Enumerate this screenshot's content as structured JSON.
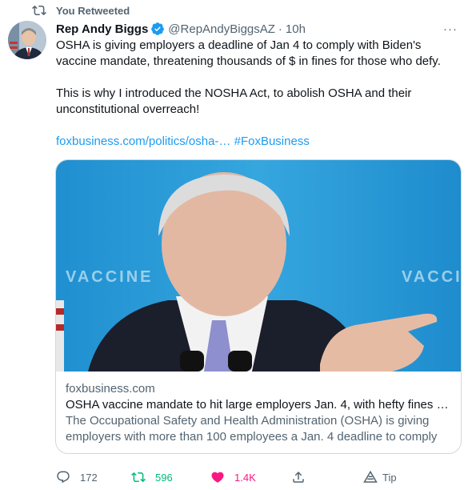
{
  "retweet_banner": {
    "label": "You Retweeted"
  },
  "author": {
    "name": "Rep Andy Biggs",
    "handle": "@RepAndyBiggsAZ",
    "separator": "·",
    "time": "10h"
  },
  "more_label": "···",
  "body": {
    "paragraph_1": "OSHA is giving employers a deadline of Jan 4 to comply with Biden's vaccine mandate, threatening thousands of $ in fines for those who defy.",
    "paragraph_2": "This is why I introduced the NOSHA Act, to abolish OSHA and their unconstitutional overreach!",
    "link": "foxbusiness.com/politics/osha-…",
    "hashtag": "#FoxBusiness"
  },
  "card": {
    "image_watermark_text": "VACCINE",
    "domain": "foxbusiness.com",
    "title": "OSHA vaccine mandate to hit large employers Jan. 4, with hefty fines …",
    "description": "The Occupational Safety and Health Administration (OSHA) is giving employers with more than 100 employees a Jan. 4 deadline to comply …"
  },
  "actions": {
    "replies": "172",
    "retweets": "596",
    "likes": "1.4K",
    "tip": "Tip"
  },
  "colors": {
    "link": "#1d9bf0",
    "retweet_active": "#00ba7c",
    "like_active": "#f91880",
    "secondary_text": "#536471",
    "card_sky": "#2ba3dc"
  },
  "icons": [
    "retweet-icon",
    "verified-badge-icon",
    "more-icon",
    "reply-icon",
    "retweet-icon",
    "heart-icon",
    "share-icon",
    "tip-icon"
  ]
}
